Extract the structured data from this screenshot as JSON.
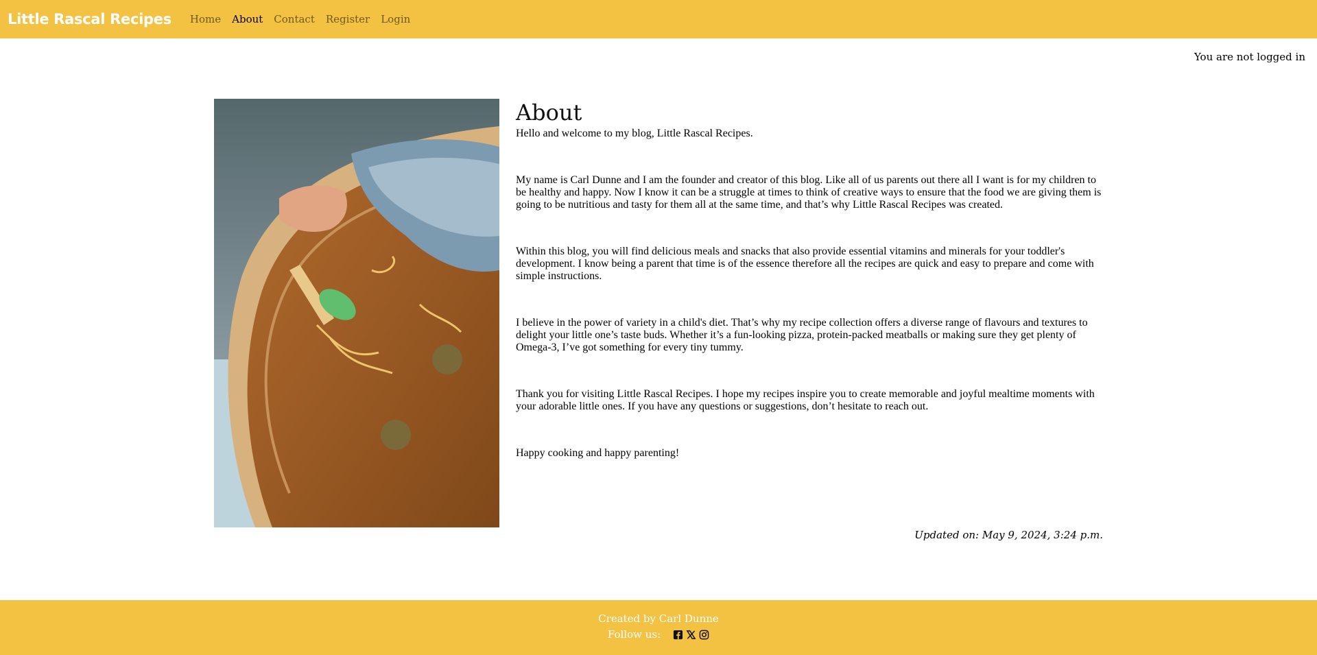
{
  "navbar": {
    "brand": "Little Rascal Recipes",
    "links": [
      "Home",
      "About",
      "Contact",
      "Register",
      "Login"
    ],
    "active": "About",
    "background_color": "#f3c242"
  },
  "auth_status": "You are not logged in",
  "about": {
    "title": "About",
    "paragraphs": [
      "Hello and welcome to my blog, Little Rascal Recipes.",
      "My name is Carl Dunne and I am the founder and creator of this blog. Like all of us parents out there all I want is for my children to be healthy and happy. Now I know it can be a struggle at times to think of creative ways to ensure that the food we are giving them is going to be nutritious and tasty for them all at the same time, and that’s why Little Rascal Recipes was created.",
      "Within this blog, you will find delicious meals and snacks that also provide essential vitamins and minerals for your toddler's development. I know being a parent that time is of the essence therefore all the recipes are quick and easy to prepare and come with simple instructions.",
      "I believe in the power of variety in a child's diet. That’s why my recipe collection offers a diverse range of flavours and textures to delight your little one’s taste buds. Whether it’s a fun-looking pizza, protein-packed meatballs or making sure they get plenty of Omega-3, I’ve got something for every tiny tummy.",
      "Thank you for visiting Little Rascal Recipes. I hope my recipes inspire you to create memorable and joyful mealtime moments with your adorable little ones. If you have any questions or suggestions, don’t hesitate to reach out.",
      "Happy cooking and happy parenting!"
    ],
    "updated": "Updated on: May 9, 2024, 3:24 p.m."
  },
  "footer": {
    "created_by": "Created by Carl Dunne",
    "follow_label": "Follow us:",
    "social_icons": [
      "facebook-icon",
      "x-twitter-icon",
      "instagram-icon"
    ]
  }
}
